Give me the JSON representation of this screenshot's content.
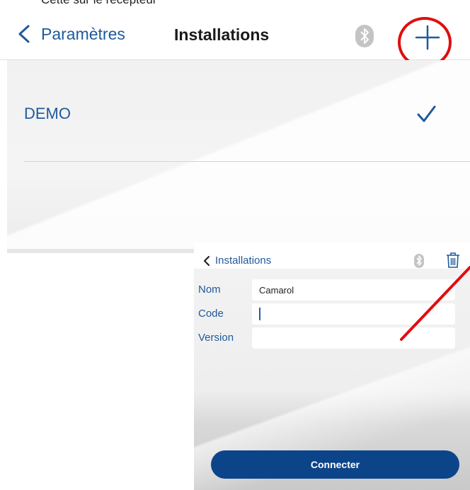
{
  "top_caption": "Cette sur le récepteur",
  "screen1": {
    "back_label": "Paramètres",
    "title": "Installations",
    "installations": [
      {
        "name": "DEMO",
        "selected": true
      }
    ]
  },
  "screen2": {
    "back_label": "Installations",
    "fields": {
      "nom_label": "Nom",
      "nom_value": "Camarol",
      "code_label": "Code",
      "code_value": "",
      "version_label": "Version",
      "version_value": ""
    },
    "connect_label": "Connecter"
  },
  "icons": {
    "back": "chevron-left-icon",
    "bluetooth": "bluetooth-icon",
    "add": "plus-icon",
    "check": "checkmark-icon",
    "delete": "trash-icon"
  },
  "colors": {
    "accent_blue": "#1f5a9b",
    "button_blue": "#0c4489",
    "annotation_red": "#e00e0e",
    "bluetooth_gray": "#c4c4c4"
  }
}
